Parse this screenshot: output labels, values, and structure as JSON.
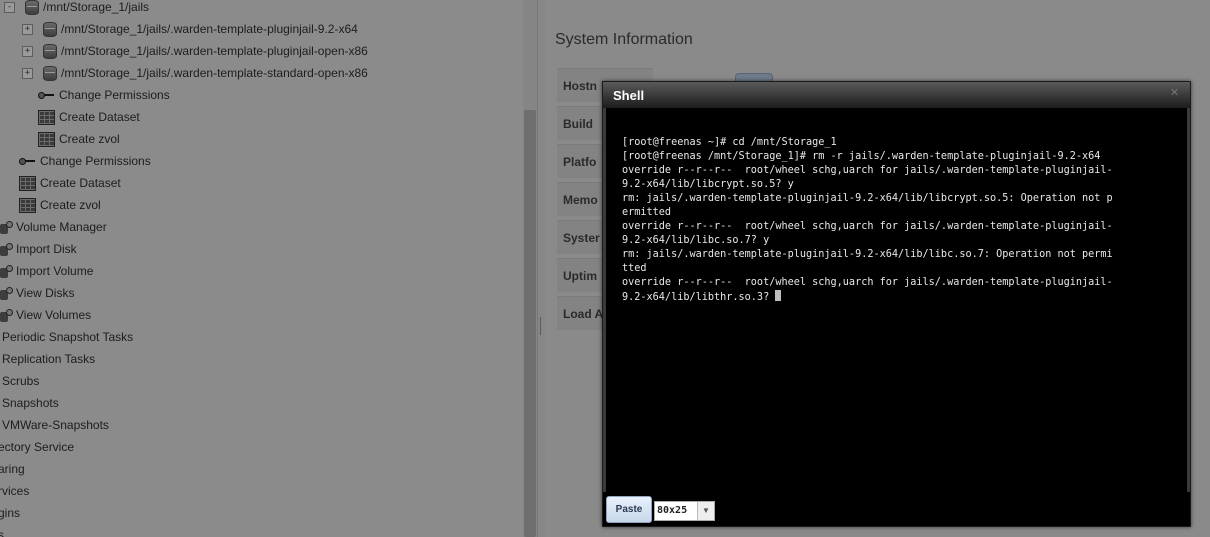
{
  "tree": {
    "items": [
      {
        "label": "/mnt/Storage_1/jails",
        "icon": "database-icon",
        "expander": "-"
      },
      {
        "label": "/mnt/Storage_1/jails/.warden-template-pluginjail-9.2-x64",
        "icon": "database-icon",
        "expander": "+"
      },
      {
        "label": "/mnt/Storage_1/jails/.warden-template-pluginjail-open-x86",
        "icon": "database-icon",
        "expander": "+"
      },
      {
        "label": "/mnt/Storage_1/jails/.warden-template-standard-open-x86",
        "icon": "database-icon",
        "expander": "+"
      },
      {
        "label": "Change Permissions",
        "icon": "key-icon"
      },
      {
        "label": "Create Dataset",
        "icon": "grid-icon"
      },
      {
        "label": "Create zvol",
        "icon": "grid-icon"
      },
      {
        "label": "Change Permissions",
        "icon": "key-icon"
      },
      {
        "label": "Create Dataset",
        "icon": "grid-icon"
      },
      {
        "label": "Create zvol",
        "icon": "grid-icon"
      },
      {
        "label": "Volume Manager",
        "icon": "volume-icon"
      },
      {
        "label": "Import Disk",
        "icon": "volume-icon"
      },
      {
        "label": "Import Volume",
        "icon": "volume-icon"
      },
      {
        "label": "View Disks",
        "icon": "volume-icon"
      },
      {
        "label": "View Volumes",
        "icon": "volume-icon"
      },
      {
        "label": "Periodic Snapshot Tasks"
      },
      {
        "label": "Replication Tasks"
      },
      {
        "label": "Scrubs"
      },
      {
        "label": "Snapshots"
      },
      {
        "label": "VMWare-Snapshots"
      },
      {
        "label": "ectory Service"
      },
      {
        "label": "aring"
      },
      {
        "label": "rvices"
      },
      {
        "label": "gins"
      },
      {
        "label": "s"
      }
    ]
  },
  "system_info": {
    "title": "System Information",
    "rows": [
      "Hostn",
      "Build",
      "Platfo",
      "Memo",
      "Syster",
      "Uptim",
      "Load A"
    ]
  },
  "shell": {
    "title": "Shell",
    "close_glyph": "✕",
    "lines": [
      "[root@freenas ~]# cd /mnt/Storage_1",
      "[root@freenas /mnt/Storage_1]# rm -r jails/.warden-template-pluginjail-9.2-x64",
      "override r--r--r--  root/wheel schg,uarch for jails/.warden-template-pluginjail-",
      "9.2-x64/lib/libcrypt.so.5? y",
      "rm: jails/.warden-template-pluginjail-9.2-x64/lib/libcrypt.so.5: Operation not p",
      "ermitted",
      "override r--r--r--  root/wheel schg,uarch for jails/.warden-template-pluginjail-",
      "9.2-x64/lib/libc.so.7? y",
      "rm: jails/.warden-template-pluginjail-9.2-x64/lib/libc.so.7: Operation not permi",
      "tted",
      "override r--r--r--  root/wheel schg,uarch for jails/.warden-template-pluginjail-",
      "9.2-x64/lib/libthr.so.3? "
    ],
    "paste_label": "Paste",
    "size_value": "80x25"
  }
}
